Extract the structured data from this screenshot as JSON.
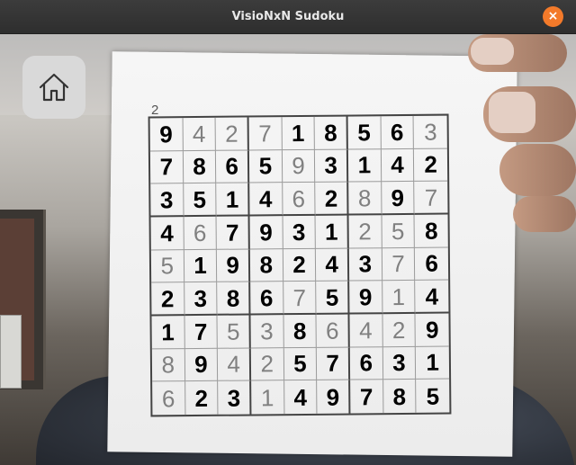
{
  "window": {
    "title": "VisioNxN Sudoku",
    "close_label": "×"
  },
  "toolbar": {
    "home_icon": "home-icon"
  },
  "puzzle": {
    "number": "2",
    "grid": [
      [
        "9",
        "4",
        "2",
        "7",
        "1",
        "8",
        "5",
        "6",
        "3"
      ],
      [
        "7",
        "8",
        "6",
        "5",
        "9",
        "3",
        "1",
        "4",
        "2"
      ],
      [
        "3",
        "5",
        "1",
        "4",
        "6",
        "2",
        "8",
        "9",
        "7"
      ],
      [
        "4",
        "6",
        "7",
        "9",
        "3",
        "1",
        "2",
        "5",
        "8"
      ],
      [
        "5",
        "1",
        "9",
        "8",
        "2",
        "4",
        "3",
        "7",
        "6"
      ],
      [
        "2",
        "3",
        "8",
        "6",
        "7",
        "5",
        "9",
        "1",
        "4"
      ],
      [
        "1",
        "7",
        "5",
        "3",
        "8",
        "6",
        "4",
        "2",
        "9"
      ],
      [
        "8",
        "9",
        "4",
        "2",
        "5",
        "7",
        "6",
        "3",
        "1"
      ],
      [
        "6",
        "2",
        "3",
        "1",
        "4",
        "9",
        "7",
        "8",
        "5"
      ]
    ],
    "printed_mask": [
      [
        0,
        1,
        1,
        1,
        0,
        0,
        0,
        0,
        1
      ],
      [
        0,
        0,
        0,
        0,
        1,
        0,
        0,
        0,
        0
      ],
      [
        0,
        0,
        0,
        0,
        1,
        0,
        1,
        0,
        1
      ],
      [
        0,
        1,
        0,
        0,
        0,
        0,
        1,
        1,
        0
      ],
      [
        1,
        0,
        0,
        0,
        0,
        0,
        0,
        1,
        0
      ],
      [
        0,
        0,
        0,
        0,
        1,
        0,
        0,
        1,
        0
      ],
      [
        0,
        0,
        1,
        1,
        0,
        1,
        1,
        1,
        0
      ],
      [
        1,
        0,
        1,
        1,
        0,
        0,
        0,
        0,
        0
      ],
      [
        1,
        0,
        0,
        1,
        0,
        0,
        0,
        0,
        0
      ]
    ]
  }
}
